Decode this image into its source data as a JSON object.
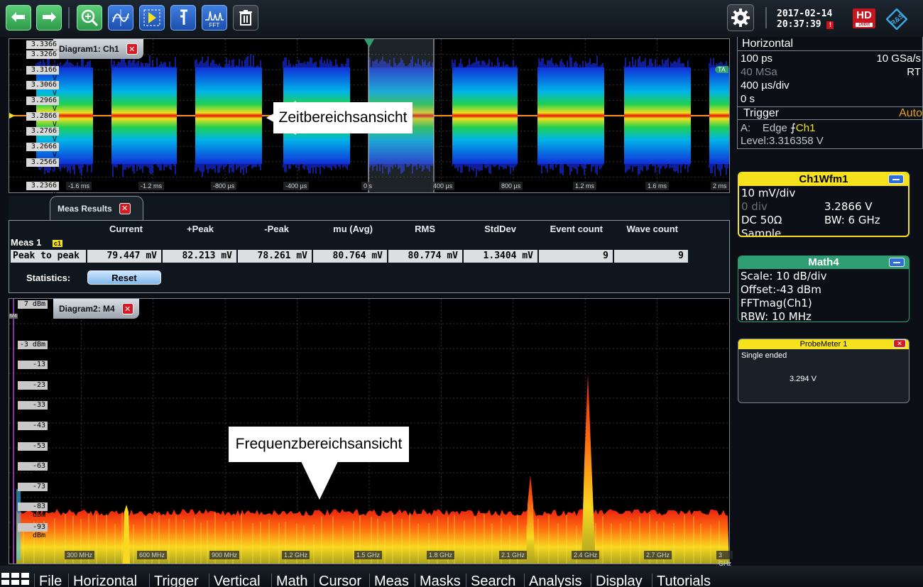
{
  "toolbar": {
    "buttons": [
      {
        "name": "undo-button",
        "icon": "undo-arrow-icon"
      },
      {
        "name": "redo-button",
        "icon": "redo-arrow-icon"
      },
      {
        "name": "zoom-button",
        "icon": "magnifier-zoom-icon"
      },
      {
        "name": "measure-button",
        "icon": "waveform-measure-icon"
      },
      {
        "name": "histogram-button",
        "icon": "cursor-select-icon"
      },
      {
        "name": "cursor-button",
        "icon": "cursor-lines-icon"
      },
      {
        "name": "fft-button",
        "icon": "fft-icon",
        "label": "FFT"
      },
      {
        "name": "delete-button",
        "icon": "trash-icon"
      }
    ],
    "settings_icon": "gear-icon",
    "date": "2017-02-14",
    "time": "20:37:39",
    "hd_badge": "HD",
    "hd_sub": "16bit",
    "logo": "R&S"
  },
  "diagram1": {
    "title": "Diagram1: Ch1",
    "ylabels": [
      "3.3366 V",
      "3.3266 V",
      "3.3166 V",
      "3.3066 V",
      "3.2966 V",
      "3.2866 V",
      "3.2766 V",
      "3.2666 V",
      "3.2566 V",
      "3.2366 V"
    ],
    "xlabels": [
      "-1.6 ms",
      "-1.2 ms",
      "-800 µs",
      "-400 µs",
      "0 s",
      "400 µs",
      "800 µs",
      "1.2 ms",
      "1.6 ms",
      "2 ms"
    ],
    "callout": "Zeitbereichsansicht",
    "trigger_tag": "TA"
  },
  "meas": {
    "tab": "Meas Results",
    "headers": [
      "Current",
      "+Peak",
      "-Peak",
      "mu (Avg)",
      "RMS",
      "StdDev",
      "Event count",
      "Wave count"
    ],
    "group": "Meas 1",
    "group_badge": "c1",
    "row_label": "Peak to peak",
    "values": [
      "79.447 mV",
      "82.213 mV",
      "78.261 mV",
      "80.764 mV",
      "80.774 mV",
      "1.3404 mV",
      "9",
      "9"
    ],
    "stats_label": "Statistics:",
    "reset": "Reset"
  },
  "diagram2": {
    "title": "Diagram2: M4",
    "ylabels": [
      "7 dBm",
      "-3 dBm",
      "-13 dBm",
      "-23 dBm",
      "-33 dBm",
      "-43 dBm",
      "-53 dBm",
      "-63 dBm",
      "-73 dBm",
      "-83 dBm",
      "-93 dBm"
    ],
    "xlabels": [
      "300 MHz",
      "600 MHz",
      "900 MHz",
      "1.2 GHz",
      "1.5 GHz",
      "1.8 GHz",
      "2.1 GHz",
      "2.4 GHz",
      "2.7 GHz",
      "3 GHz"
    ],
    "callout": "Frequenzbereichsansicht",
    "marker": "M4"
  },
  "horizontal": {
    "title": "Horizontal",
    "resolution": "100 ps",
    "sample_rate": "10 GSa/s",
    "record": "40 MSa",
    "mode": "RT",
    "timebase": "400 µs/div",
    "position": "0 s"
  },
  "trigger": {
    "title": "Trigger",
    "mode": "Auto",
    "source_label": "A:",
    "type": "Edge",
    "channel": "Ch1",
    "level": "Level:3.316358 V"
  },
  "ch1": {
    "title": "Ch1Wfm1",
    "scale": "10 mV/div",
    "offset": "0 div",
    "value": "3.2866 V",
    "coupling": "DC 50Ω",
    "bw": "BW: 6 GHz",
    "acq": "Sample",
    "color": "#f5e21c"
  },
  "math4": {
    "title": "Math4",
    "scale": "Scale:  10 dB/div",
    "offset": "Offset:-43 dBm",
    "expr": "FFTmag(Ch1)",
    "rbw": "RBW:  10 MHz",
    "color": "#2f9e72"
  },
  "probe": {
    "title": "ProbeMeter 1",
    "mode": "Single ended",
    "value": "3.294 V"
  },
  "menu": [
    "File",
    "Horizontal",
    "Trigger",
    "Vertical",
    "Math",
    "Cursor",
    "Meas",
    "Masks",
    "Search",
    "Analysis",
    "Display",
    "Tutorials"
  ],
  "menu_icon": "app-grid-icon"
}
